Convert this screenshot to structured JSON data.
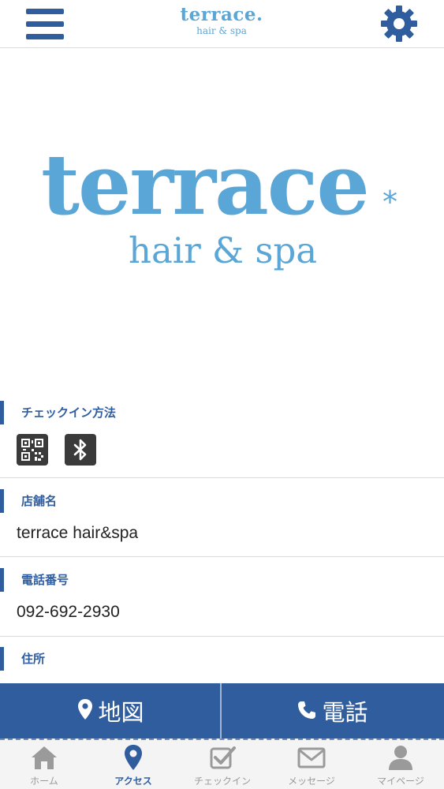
{
  "header": {
    "logo_line1": "terrace.",
    "logo_line2": "hair & spa"
  },
  "hero": {
    "logo_main": "terrace",
    "logo_mark": "*",
    "logo_sub": "hair & spa"
  },
  "sections": {
    "checkin_method": {
      "label": "チェックイン方法",
      "methods": [
        "qr-code-icon",
        "bluetooth-icon"
      ]
    },
    "store_name": {
      "label": "店舗名",
      "value": "terrace hair&spa"
    },
    "phone": {
      "label": "電話番号",
      "value": "092-692-2930"
    },
    "address": {
      "label": "住所"
    }
  },
  "actions": {
    "map_label": "地図",
    "call_label": "電話"
  },
  "tabs": [
    {
      "label": "ホーム",
      "icon": "home-icon"
    },
    {
      "label": "アクセス",
      "icon": "map-pin-icon",
      "active": true
    },
    {
      "label": "チェックイン",
      "icon": "checkbox-icon"
    },
    {
      "label": "メッセージ",
      "icon": "envelope-icon"
    },
    {
      "label": "マイページ",
      "icon": "user-icon"
    }
  ],
  "colors": {
    "primary": "#2f5d9e",
    "logo": "#5aa6d6",
    "tab_inactive": "#9a9a9a"
  }
}
